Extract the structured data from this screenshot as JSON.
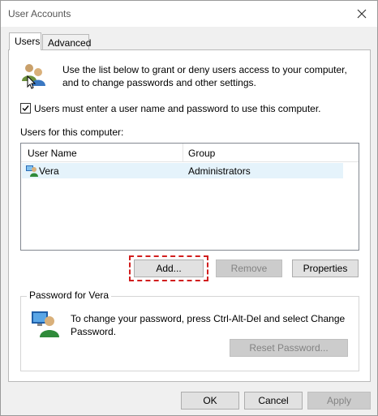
{
  "window": {
    "title": "User Accounts"
  },
  "tabs": [
    {
      "label": "Users",
      "active": true
    },
    {
      "label": "Advanced",
      "active": false
    }
  ],
  "intro": {
    "text": "Use the list below to grant or deny users access to your computer, and to change passwords and other settings."
  },
  "require_login": {
    "label": "Users must enter a user name and password to use this computer.",
    "checked": true
  },
  "users_list": {
    "label": "Users for this computer:",
    "columns": [
      "User Name",
      "Group"
    ],
    "rows": [
      {
        "name": "Vera",
        "group": "Administrators"
      }
    ]
  },
  "user_buttons": {
    "add": "Add...",
    "remove": "Remove",
    "properties": "Properties"
  },
  "password_group": {
    "title": "Password for Vera",
    "text": "To change your password, press Ctrl-Alt-Del and select Change Password.",
    "reset_button": "Reset Password..."
  },
  "footer": {
    "ok": "OK",
    "cancel": "Cancel",
    "apply": "Apply"
  },
  "colors": {
    "highlight": "#d11e1e",
    "selected_row": "#e5f3fb"
  }
}
